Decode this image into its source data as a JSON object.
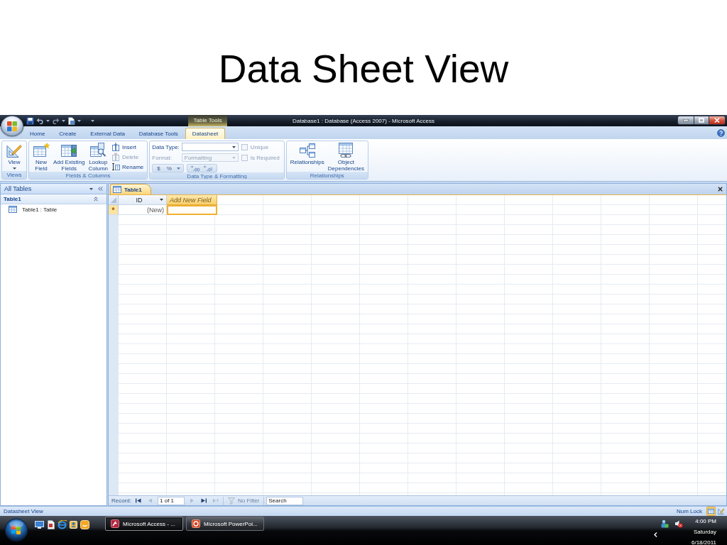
{
  "slide": {
    "title": "Data Sheet View"
  },
  "window": {
    "title": "Database1 : Database (Access 2007) - Microsoft Access",
    "contextual_tab_group": "Table Tools"
  },
  "ribbon": {
    "tabs": [
      {
        "label": "Home",
        "selected": false
      },
      {
        "label": "Create",
        "selected": false
      },
      {
        "label": "External Data",
        "selected": false
      },
      {
        "label": "Database Tools",
        "selected": false
      },
      {
        "label": "Datasheet",
        "selected": true
      }
    ],
    "groups": [
      {
        "label": "Views",
        "kind": "buttons",
        "large_buttons": [
          {
            "label": "View",
            "dropdown": true
          }
        ]
      },
      {
        "label": "Fields & Columns",
        "kind": "buttons",
        "large_buttons": [
          {
            "label": "New\nField",
            "dropdown": false
          },
          {
            "label": "Add Existing\nFields",
            "dropdown": false
          },
          {
            "label": "Lookup\nColumn",
            "dropdown": false
          }
        ],
        "small_buttons": [
          {
            "label": "Insert",
            "disabled": false
          },
          {
            "label": "Delete",
            "disabled": true
          },
          {
            "label": "Rename",
            "disabled": false
          }
        ]
      },
      {
        "label": "Data Type & Formatting",
        "kind": "formatting",
        "fields": [
          {
            "label": "Data Type:",
            "disabled": false
          },
          {
            "label": "Format:",
            "value": "Formatting",
            "disabled": true
          }
        ],
        "format_buttons": [
          "$",
          "%"
        ],
        "checkboxes": [
          {
            "label": "Unique",
            "checked": false,
            "disabled": true
          },
          {
            "label": "Is Required",
            "checked": false,
            "disabled": true
          }
        ]
      },
      {
        "label": "Relationships",
        "kind": "buttons",
        "large_buttons": [
          {
            "label": "Relationships",
            "dropdown": false
          },
          {
            "label": "Object\nDependencies",
            "dropdown": false
          }
        ]
      }
    ]
  },
  "navigation_pane": {
    "header": "All Tables",
    "groups": [
      {
        "label": "Table1",
        "expanded": true,
        "items": [
          {
            "label": "Table1 : Table",
            "selected": false
          }
        ]
      }
    ]
  },
  "document": {
    "tabs": [
      {
        "label": "Table1",
        "selected": true
      }
    ],
    "columns": [
      {
        "label": "ID",
        "kind": "field",
        "selected": false
      },
      {
        "label": "Add New Field",
        "kind": "add",
        "selected": true
      }
    ],
    "rows": [
      {
        "marker": "*",
        "cells": [
          {
            "value": "(New)",
            "selected": false
          },
          {
            "selected": true
          }
        ]
      }
    ],
    "record_navigator": {
      "label": "Record:",
      "position": "1 of 1",
      "buttons": [
        {
          "kind": "first",
          "disabled": false
        },
        {
          "kind": "previous",
          "disabled": true
        },
        {
          "kind": "next",
          "disabled": true
        },
        {
          "kind": "last",
          "disabled": false
        },
        {
          "kind": "new",
          "disabled": true
        }
      ],
      "filter": {
        "label": "No Filter",
        "disabled": true
      },
      "search": {
        "placeholder": "Search"
      }
    }
  },
  "status_bar": {
    "text": "Datasheet View",
    "indicator": "Num Lock",
    "views": [
      {
        "selected": true
      },
      {
        "selected": false
      }
    ]
  },
  "taskbar": {
    "tasks": [
      {
        "label": "Microsoft Access - ...",
        "selected": true
      },
      {
        "label": "Microsoft PowerPoi...",
        "selected": false
      }
    ],
    "tray": {
      "volume_muted": true
    },
    "clock": {
      "time": "4:00 PM",
      "day": "Saturday",
      "date": "6/18/2011"
    }
  }
}
